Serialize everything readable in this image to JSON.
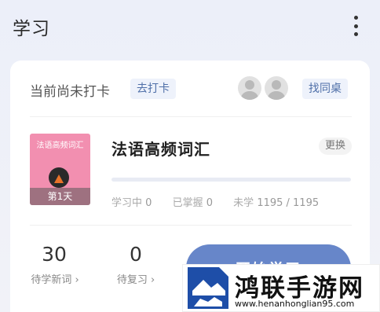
{
  "header": {
    "title": "学习",
    "more_icon": "more-vertical-icon"
  },
  "checkin": {
    "status_text": "当前尚未打卡",
    "checkin_label": "去打卡",
    "find_deskmate_label": "找同桌"
  },
  "book": {
    "cover_title": "法语高频词汇",
    "cover_day": "第1天",
    "name": "法语高频词汇",
    "change_label": "更换",
    "progress": 0,
    "stats": {
      "learning_label": "学习中",
      "learning_value": "0",
      "mastered_label": "已掌握",
      "mastered_value": "0",
      "unlearned_label": "未学",
      "unlearned_value": "1195 / 1195"
    }
  },
  "summary": {
    "new_words_count": "30",
    "new_words_label": "待学新词 ›",
    "review_count": "0",
    "review_label": "待复习 ›",
    "start_button_label": "开始学习"
  },
  "watermark": {
    "title": "鸿联手游网",
    "url": "www.henanhonglian95.com"
  },
  "colors": {
    "accent": "#5b79bd",
    "button": "#6786c9",
    "cover": "#f28fb0"
  }
}
